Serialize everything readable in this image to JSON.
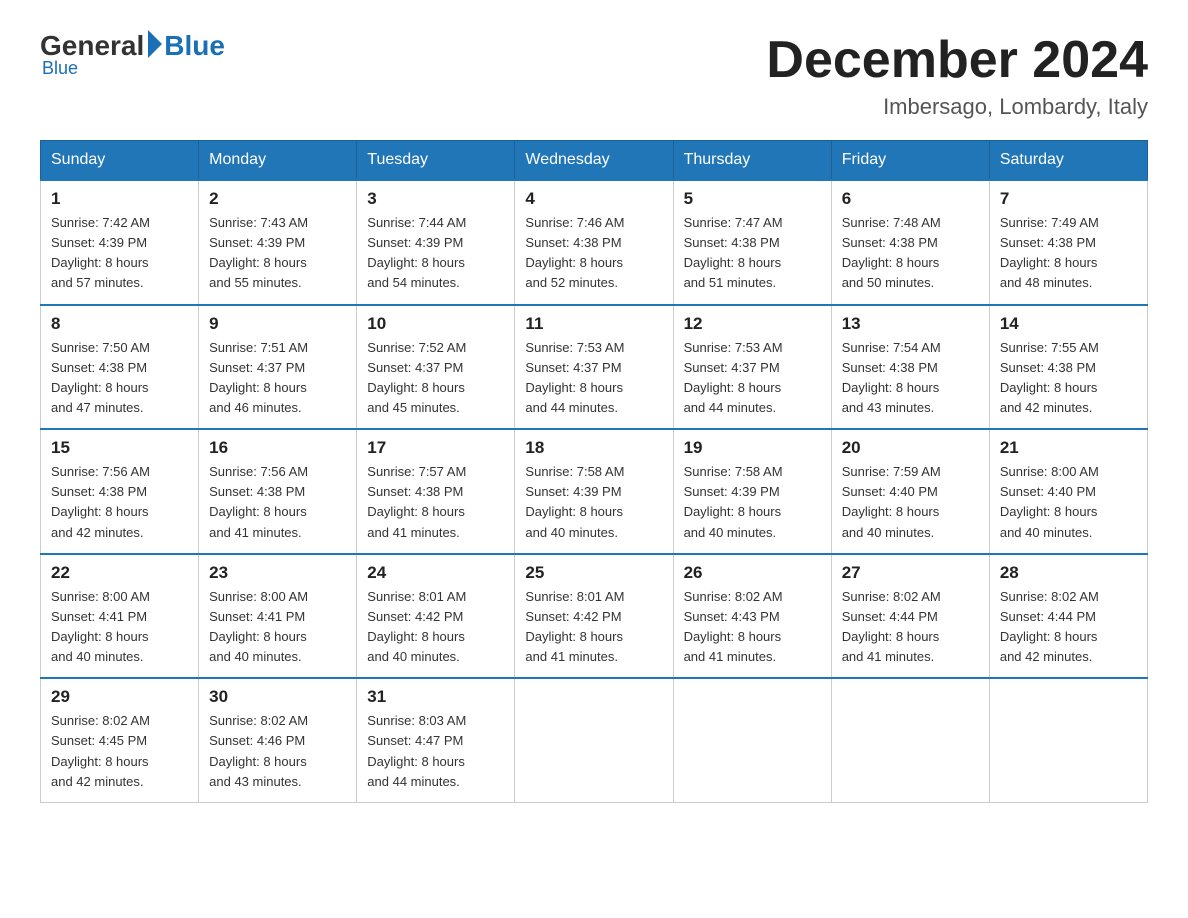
{
  "header": {
    "logo": {
      "general": "General",
      "blue": "Blue"
    },
    "title": "December 2024",
    "location": "Imbersago, Lombardy, Italy"
  },
  "calendar": {
    "headers": [
      "Sunday",
      "Monday",
      "Tuesday",
      "Wednesday",
      "Thursday",
      "Friday",
      "Saturday"
    ],
    "weeks": [
      [
        {
          "day": "1",
          "sunrise": "7:42 AM",
          "sunset": "4:39 PM",
          "daylight": "8 hours and 57 minutes."
        },
        {
          "day": "2",
          "sunrise": "7:43 AM",
          "sunset": "4:39 PM",
          "daylight": "8 hours and 55 minutes."
        },
        {
          "day": "3",
          "sunrise": "7:44 AM",
          "sunset": "4:39 PM",
          "daylight": "8 hours and 54 minutes."
        },
        {
          "day": "4",
          "sunrise": "7:46 AM",
          "sunset": "4:38 PM",
          "daylight": "8 hours and 52 minutes."
        },
        {
          "day": "5",
          "sunrise": "7:47 AM",
          "sunset": "4:38 PM",
          "daylight": "8 hours and 51 minutes."
        },
        {
          "day": "6",
          "sunrise": "7:48 AM",
          "sunset": "4:38 PM",
          "daylight": "8 hours and 50 minutes."
        },
        {
          "day": "7",
          "sunrise": "7:49 AM",
          "sunset": "4:38 PM",
          "daylight": "8 hours and 48 minutes."
        }
      ],
      [
        {
          "day": "8",
          "sunrise": "7:50 AM",
          "sunset": "4:38 PM",
          "daylight": "8 hours and 47 minutes."
        },
        {
          "day": "9",
          "sunrise": "7:51 AM",
          "sunset": "4:37 PM",
          "daylight": "8 hours and 46 minutes."
        },
        {
          "day": "10",
          "sunrise": "7:52 AM",
          "sunset": "4:37 PM",
          "daylight": "8 hours and 45 minutes."
        },
        {
          "day": "11",
          "sunrise": "7:53 AM",
          "sunset": "4:37 PM",
          "daylight": "8 hours and 44 minutes."
        },
        {
          "day": "12",
          "sunrise": "7:53 AM",
          "sunset": "4:37 PM",
          "daylight": "8 hours and 44 minutes."
        },
        {
          "day": "13",
          "sunrise": "7:54 AM",
          "sunset": "4:38 PM",
          "daylight": "8 hours and 43 minutes."
        },
        {
          "day": "14",
          "sunrise": "7:55 AM",
          "sunset": "4:38 PM",
          "daylight": "8 hours and 42 minutes."
        }
      ],
      [
        {
          "day": "15",
          "sunrise": "7:56 AM",
          "sunset": "4:38 PM",
          "daylight": "8 hours and 42 minutes."
        },
        {
          "day": "16",
          "sunrise": "7:56 AM",
          "sunset": "4:38 PM",
          "daylight": "8 hours and 41 minutes."
        },
        {
          "day": "17",
          "sunrise": "7:57 AM",
          "sunset": "4:38 PM",
          "daylight": "8 hours and 41 minutes."
        },
        {
          "day": "18",
          "sunrise": "7:58 AM",
          "sunset": "4:39 PM",
          "daylight": "8 hours and 40 minutes."
        },
        {
          "day": "19",
          "sunrise": "7:58 AM",
          "sunset": "4:39 PM",
          "daylight": "8 hours and 40 minutes."
        },
        {
          "day": "20",
          "sunrise": "7:59 AM",
          "sunset": "4:40 PM",
          "daylight": "8 hours and 40 minutes."
        },
        {
          "day": "21",
          "sunrise": "8:00 AM",
          "sunset": "4:40 PM",
          "daylight": "8 hours and 40 minutes."
        }
      ],
      [
        {
          "day": "22",
          "sunrise": "8:00 AM",
          "sunset": "4:41 PM",
          "daylight": "8 hours and 40 minutes."
        },
        {
          "day": "23",
          "sunrise": "8:00 AM",
          "sunset": "4:41 PM",
          "daylight": "8 hours and 40 minutes."
        },
        {
          "day": "24",
          "sunrise": "8:01 AM",
          "sunset": "4:42 PM",
          "daylight": "8 hours and 40 minutes."
        },
        {
          "day": "25",
          "sunrise": "8:01 AM",
          "sunset": "4:42 PM",
          "daylight": "8 hours and 41 minutes."
        },
        {
          "day": "26",
          "sunrise": "8:02 AM",
          "sunset": "4:43 PM",
          "daylight": "8 hours and 41 minutes."
        },
        {
          "day": "27",
          "sunrise": "8:02 AM",
          "sunset": "4:44 PM",
          "daylight": "8 hours and 41 minutes."
        },
        {
          "day": "28",
          "sunrise": "8:02 AM",
          "sunset": "4:44 PM",
          "daylight": "8 hours and 42 minutes."
        }
      ],
      [
        {
          "day": "29",
          "sunrise": "8:02 AM",
          "sunset": "4:45 PM",
          "daylight": "8 hours and 42 minutes."
        },
        {
          "day": "30",
          "sunrise": "8:02 AM",
          "sunset": "4:46 PM",
          "daylight": "8 hours and 43 minutes."
        },
        {
          "day": "31",
          "sunrise": "8:03 AM",
          "sunset": "4:47 PM",
          "daylight": "8 hours and 44 minutes."
        },
        null,
        null,
        null,
        null
      ]
    ]
  }
}
